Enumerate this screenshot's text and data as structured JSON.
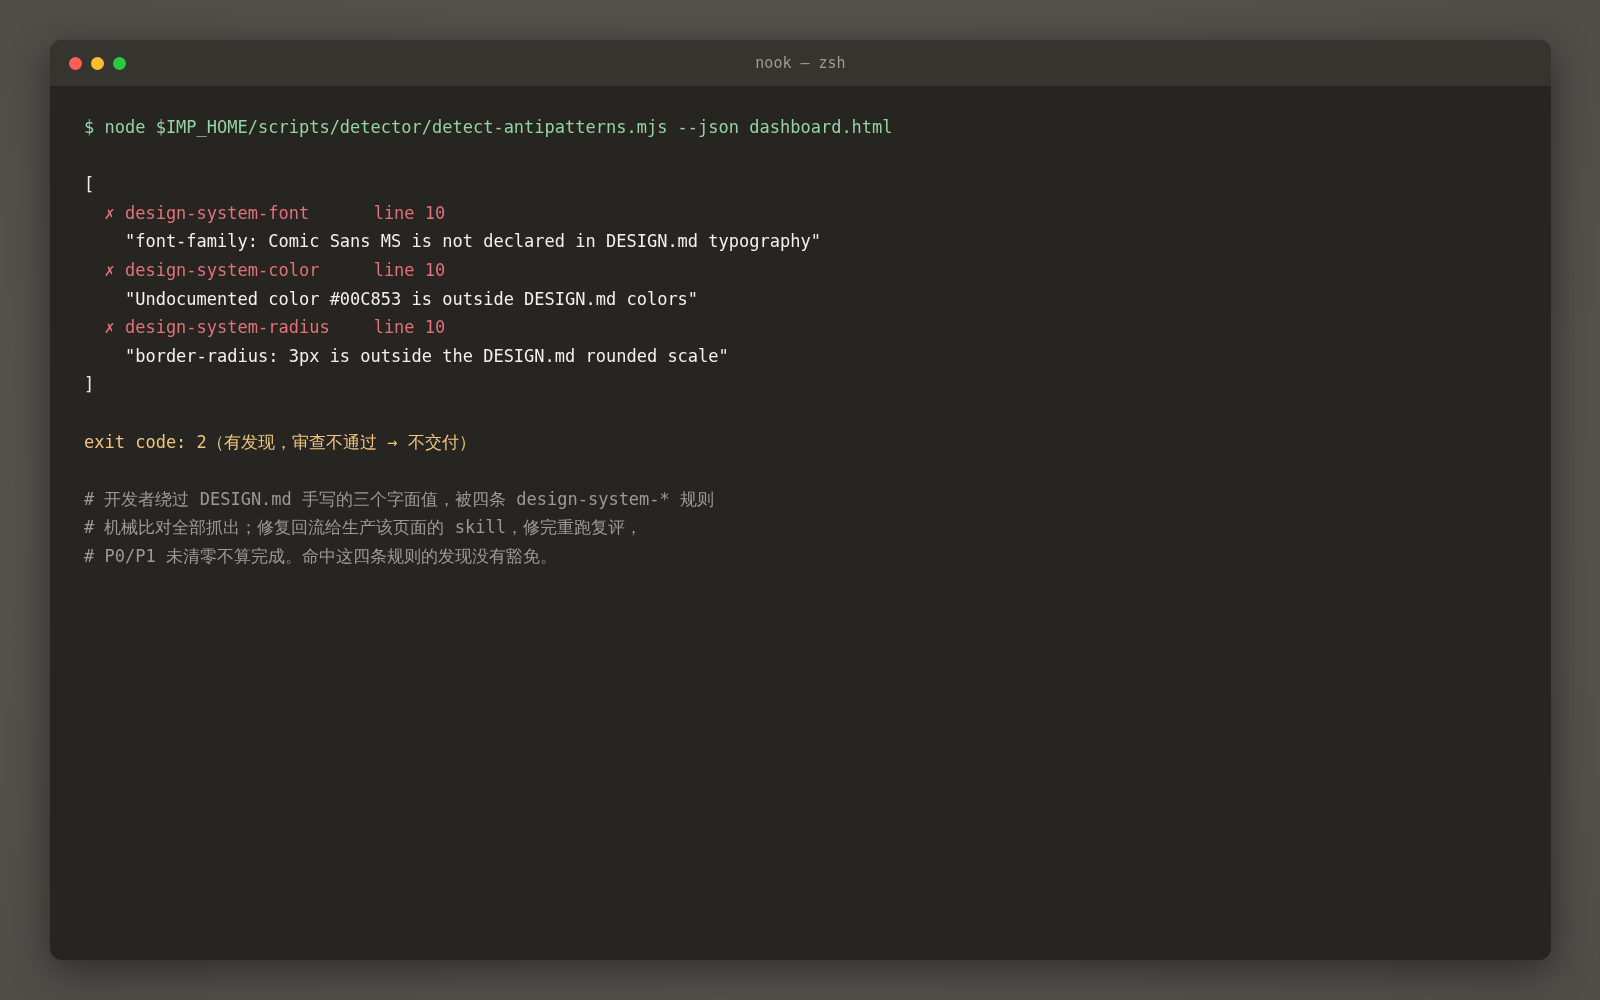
{
  "window": {
    "title": "nook — zsh"
  },
  "blocks": [
    {
      "lines": [
        {
          "kind": "command",
          "text": "$ node $IMP_HOME/scripts/detector/detect-antipatterns.mjs --json dashboard.html"
        }
      ]
    },
    {
      "lines": [
        {
          "kind": "bracket",
          "text": "["
        },
        {
          "kind": "finding",
          "marker": "✗",
          "rule": "design-system-font",
          "where": "line 10"
        },
        {
          "kind": "message",
          "text": "\"font-family: Comic Sans MS is not declared in DESIGN.md typography\""
        },
        {
          "kind": "finding",
          "marker": "✗",
          "rule": "design-system-color",
          "where": "line 10"
        },
        {
          "kind": "message",
          "text": "\"Undocumented color #00C853 is outside DESIGN.md colors\""
        },
        {
          "kind": "finding",
          "marker": "✗",
          "rule": "design-system-radius",
          "where": "line 10"
        },
        {
          "kind": "message",
          "text": "\"border-radius: 3px is outside the DESIGN.md rounded scale\""
        },
        {
          "kind": "bracket",
          "text": "]"
        }
      ]
    },
    {
      "lines": [
        {
          "kind": "exit",
          "text": "exit code: 2（有发现，审查不通过 → 不交付）"
        }
      ]
    },
    {
      "lines": [
        {
          "kind": "comment",
          "text": "# 开发者绕过 DESIGN.md 手写的三个字面值，被四条 design-system-* 规则"
        },
        {
          "kind": "comment",
          "text": "# 机械比对全部抓出；修复回流给生产该页面的 skill，修完重跑复评，"
        },
        {
          "kind": "comment",
          "text": "# P0/P1 未清零不算完成。命中这四条规则的发现没有豁免。"
        }
      ]
    }
  ]
}
